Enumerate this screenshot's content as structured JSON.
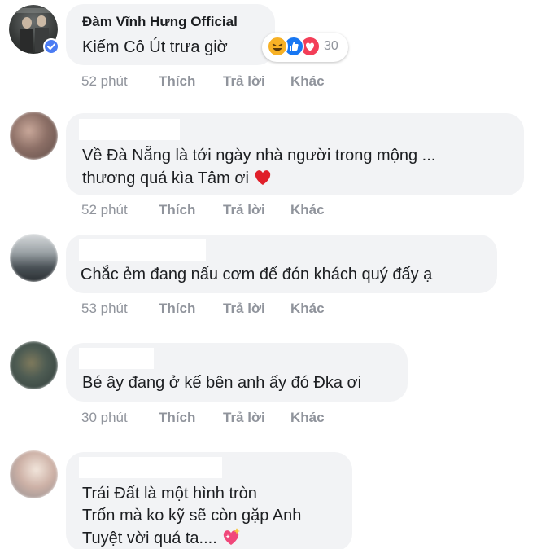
{
  "comments": [
    {
      "author": "Đàm Vĩnh Hưng Official",
      "lines": [
        "Kiếm Cô Út trưa giờ"
      ],
      "time": "52 phút",
      "reaction_count": "30"
    },
    {
      "author": "",
      "lines": [
        "Về Đà Nẵng là tới ngày nhà người trong mộng ...",
        "thương quá kìa Tâm ơi"
      ],
      "time": "52 phút"
    },
    {
      "author": "",
      "lines": [
        "Chắc ẻm đang nấu cơm để đón khách quý đấy ạ"
      ],
      "time": "53 phút"
    },
    {
      "author": "",
      "lines": [
        "Bé ây đang ở kế bên anh ấy đó Đka ơi"
      ],
      "time": "30 phút"
    },
    {
      "author": "",
      "lines": [
        "Trái Đất là một hình tròn",
        "Trốn mà ko kỹ sẽ còn gặp Anh",
        "Tuyệt vời quá ta...."
      ]
    }
  ],
  "actions": {
    "like": "Thích",
    "reply": "Trả lời",
    "more": "Khác"
  },
  "icons": {
    "verified": "verified-badge-icon",
    "haha": "haha-reaction-icon",
    "like": "like-reaction-icon",
    "love": "love-reaction-icon",
    "heart": "red-heart-emoji-icon",
    "sparkling_heart": "sparkling-heart-emoji-icon"
  },
  "colors": {
    "bubble": "#f2f3f5",
    "meta_text": "#90949c",
    "verified": "#4b7cf3",
    "love": "#f33e58",
    "like": "#1877f2",
    "haha": "#f7b125"
  }
}
